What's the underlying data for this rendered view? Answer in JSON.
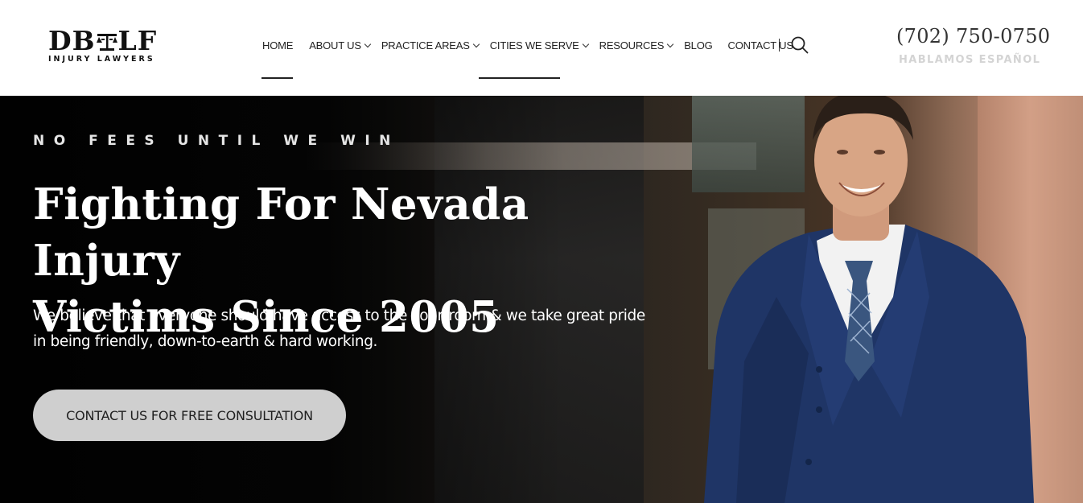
{
  "logo": {
    "main_left": "DB",
    "main_right": "LF",
    "subtitle": "INJURY LAWYERS"
  },
  "nav": {
    "items": [
      {
        "label": "HOME",
        "has_dropdown": false,
        "active": true
      },
      {
        "label": "ABOUT US",
        "has_dropdown": true
      },
      {
        "label": "PRACTICE AREAS",
        "has_dropdown": true
      },
      {
        "label": "CITIES WE SERVE",
        "has_dropdown": true,
        "active": true
      },
      {
        "label": "RESOURCES",
        "has_dropdown": true
      },
      {
        "label": "BLOG",
        "has_dropdown": false
      },
      {
        "label": "CONTACT US",
        "has_dropdown": false
      }
    ],
    "search_icon": "search-icon"
  },
  "contact": {
    "phone": "(702) 750-0750",
    "language_note": "HABLAMOS ESPAÑOL"
  },
  "hero": {
    "tagline": "NO FEES UNTIL WE WIN",
    "headline_line1": "Fighting For Nevada Injury",
    "headline_line2": "Victims Since 2005",
    "subtext_line1": "We believe that everyone should have access to the courtroom & we take great pride",
    "subtext_line2": "in being friendly, down-to-earth & hard working.",
    "cta_label": "CONTACT US FOR FREE CONSULTATION"
  },
  "colors": {
    "accent_dark": "#222222",
    "cta_bg": "#cfcfcf",
    "hablamos": "#d4d4d4",
    "suit": "#1f3566"
  }
}
